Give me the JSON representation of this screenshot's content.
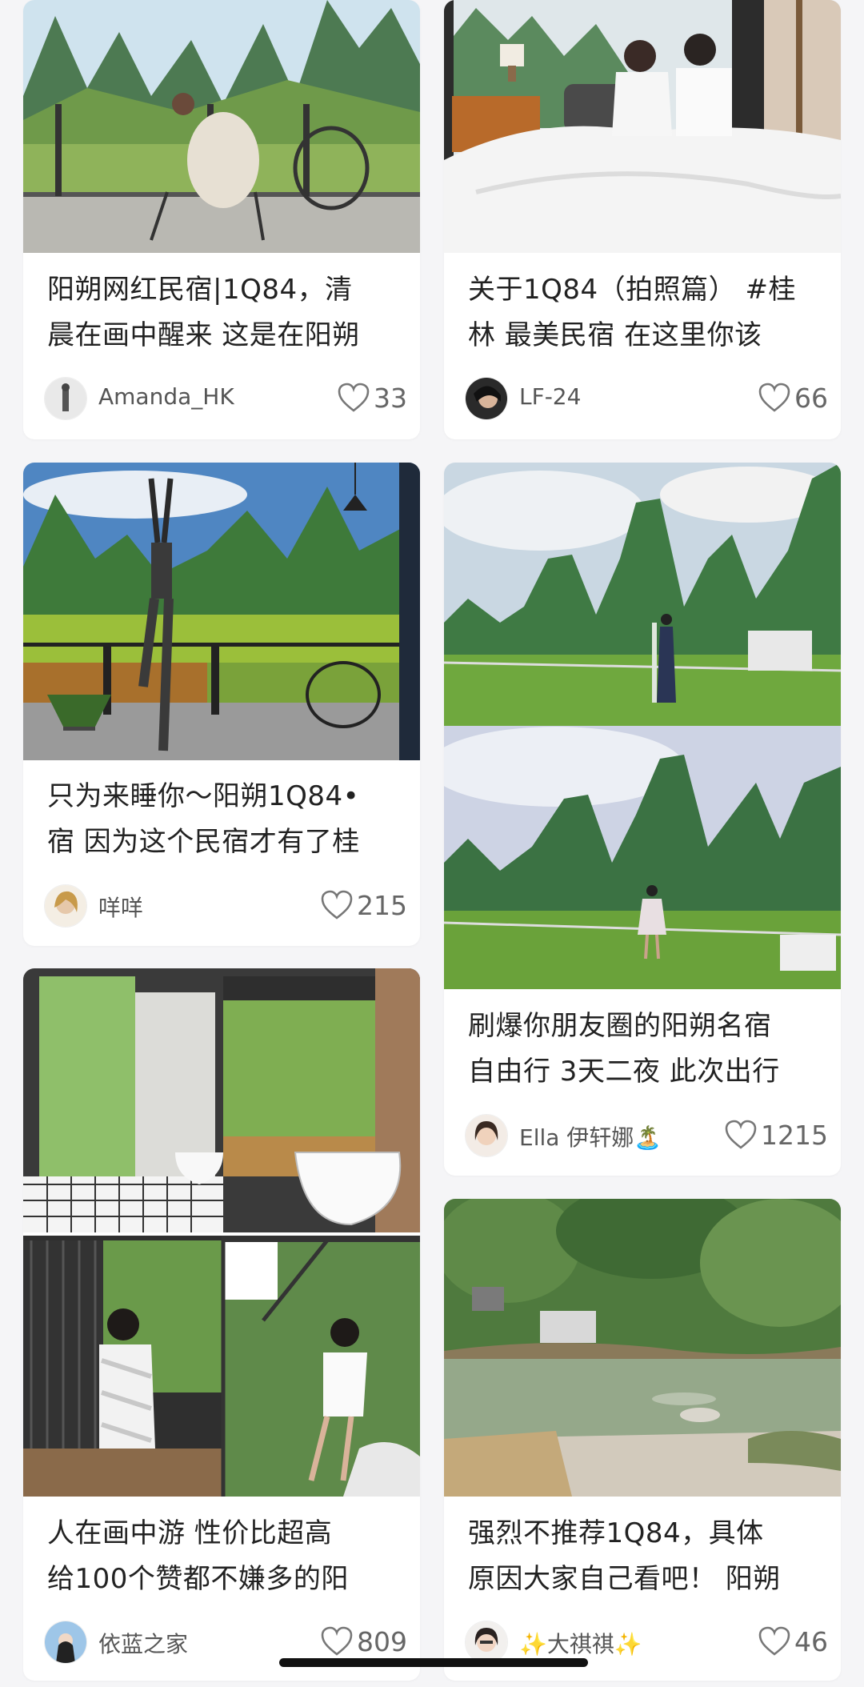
{
  "feed": {
    "cards": [
      {
        "title_line1": "阳朔网红民宿|1Q84，清",
        "title_line2": "晨在画中醒来 这是在阳朔",
        "author": "Amanda_HK",
        "likes": "33",
        "image": "balcony-chair-mountains"
      },
      {
        "title_line1": "关于1Q84（拍照篇） #桂",
        "title_line2": "林 最美民宿 在这里你该",
        "author": "LF-24",
        "likes": "66",
        "image": "couple-in-bed"
      },
      {
        "title_line1": "只为来睡你～阳朔1Q84•",
        "title_line2": "宿 因为这个民宿才有了桂",
        "author": "咩咩",
        "likes": "215",
        "image": "yoga-balcony"
      },
      {
        "title_line1": "刷爆你朋友圈的阳朔名宿",
        "title_line2": "自由行 3天二夜 此次出行",
        "author": "Ella 伊轩娜🏝️",
        "likes": "1215",
        "image": "karst-mountains-collage"
      },
      {
        "title_line1": "人在画中游 性价比超高",
        "title_line2": "给100个赞都不嫌多的阳",
        "author": "依蓝之家",
        "likes": "809",
        "image": "bathroom-balcony-collage"
      },
      {
        "title_line1": "强烈不推荐1Q84，具体",
        "title_line2": "原因大家自己看吧！ 阳朔",
        "author": "✨大祺祺✨",
        "likes": "46",
        "image": "river-forest"
      }
    ]
  },
  "colors": {
    "background": "#f5f5f7",
    "card": "#ffffff",
    "text": "#222222",
    "meta": "#666666"
  }
}
